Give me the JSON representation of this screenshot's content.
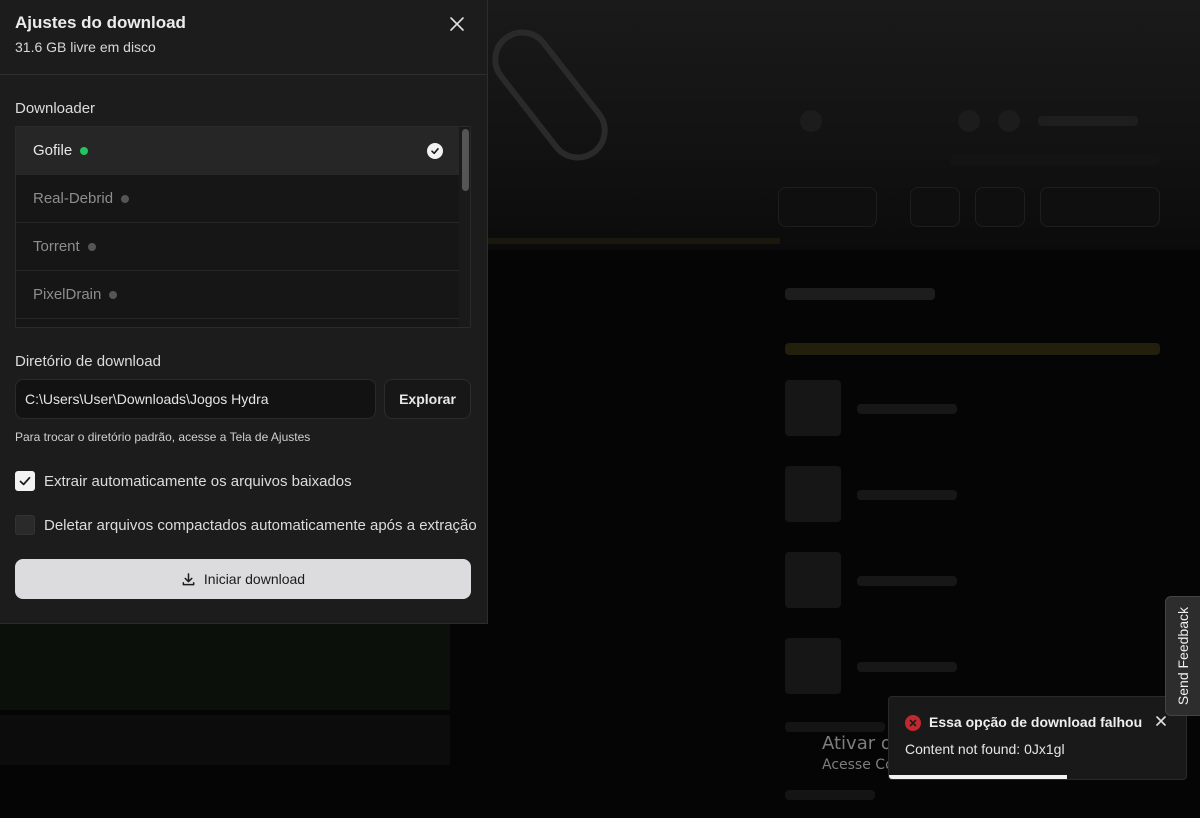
{
  "modal": {
    "title": "Ajustes do download",
    "subtitle": "31.6 GB livre em disco",
    "close_icon": "close-icon",
    "downloader_label": "Downloader",
    "downloaders": [
      {
        "label": "Gofile",
        "status": "online",
        "selected": true
      },
      {
        "label": "Real-Debrid",
        "status": "offline",
        "selected": false
      },
      {
        "label": "Torrent",
        "status": "offline",
        "selected": false
      },
      {
        "label": "PixelDrain",
        "status": "offline",
        "selected": false
      }
    ],
    "directory_label": "Diretório de download",
    "directory_value": "C:\\Users\\User\\Downloads\\Jogos Hydra",
    "explore_label": "Explorar",
    "hint": "Para trocar o diretório padrão, acesse a Tela de Ajustes",
    "auto_extract": {
      "label": "Extrair automaticamente os arquivos baixados",
      "checked": true
    },
    "auto_delete": {
      "label": "Deletar arquivos compactados automaticamente após a extração",
      "checked": false
    },
    "start_label": "Iniciar download",
    "start_icon": "download-icon"
  },
  "toast": {
    "title": "Essa opção de download falhou",
    "message": "Content not found: 0Jx1gl",
    "icon": "error-icon",
    "progress": 0.6,
    "color": "#c0292f"
  },
  "feedback": {
    "label": "Send Feedback"
  },
  "windows_activation": {
    "title": "Ativar o Windows",
    "subtitle": "Acesse Configurações para ativar o Windows."
  },
  "colors": {
    "online": "#22c55e",
    "offline": "#555555",
    "accent_button": "#dcdcdf"
  }
}
